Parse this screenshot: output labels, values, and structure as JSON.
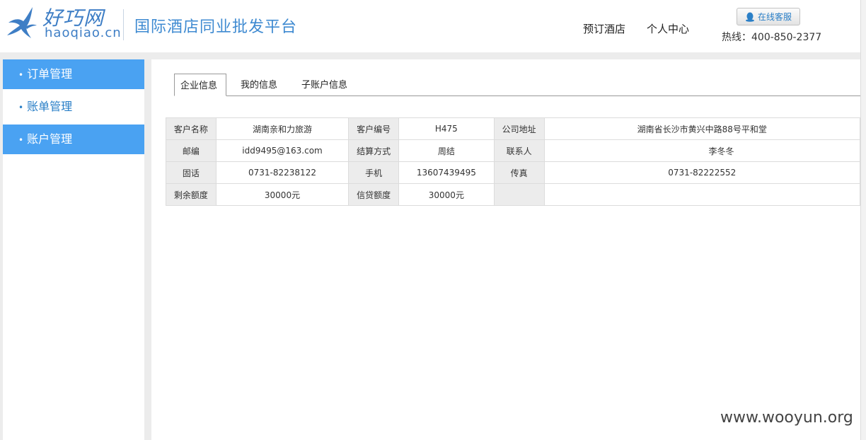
{
  "header": {
    "logo_cn": "好巧网",
    "logo_en": "haoqiao.cn",
    "slogan": "国际酒店同业批发平台",
    "nav": {
      "book_hotel": "预订酒店",
      "user_center": "个人中心"
    },
    "online_service": "在线客服",
    "hotline": "热线：400-850-2377"
  },
  "sidebar": {
    "items": [
      {
        "label": "订单管理",
        "active": true
      },
      {
        "label": "账单管理",
        "active": false
      },
      {
        "label": "账户管理",
        "active": true
      }
    ]
  },
  "tabs": [
    {
      "label": "企业信息",
      "active": true
    },
    {
      "label": "我的信息",
      "active": false
    },
    {
      "label": "子账户信息",
      "active": false
    }
  ],
  "info": {
    "customer_name_label": "客户名称",
    "customer_name": "湖南亲和力旅游",
    "customer_no_label": "客户编号",
    "customer_no": "H475",
    "address_label": "公司地址",
    "address": "湖南省长沙市黄兴中路88号平和堂",
    "zip_label": "邮编",
    "zip": "idd9495@163.com",
    "settle_label": "结算方式",
    "settle": "周结",
    "contact_label": "联系人",
    "contact": "李冬冬",
    "phone_label": "固话",
    "phone": "0731-82238122",
    "mobile_label": "手机",
    "mobile": "13607439495",
    "fax_label": "传真",
    "fax": "0731-82222552",
    "balance_label": "剩余额度",
    "balance": "30000元",
    "credit_label": "信贷额度",
    "credit": "30000元"
  },
  "watermark": "www.wooyun.org",
  "colors": {
    "brand_blue": "#3e7ec5",
    "sidebar_active": "#4aa2f2",
    "label_bg": "#ececec"
  }
}
